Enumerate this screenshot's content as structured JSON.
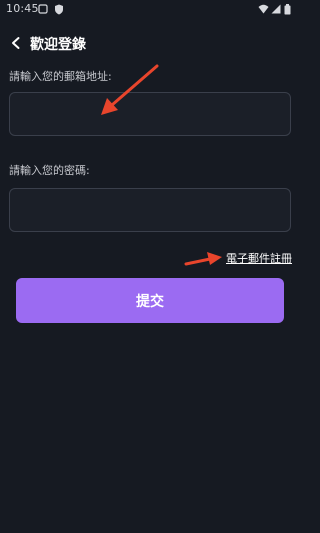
{
  "status_bar": {
    "time": "10:45",
    "icons": [
      "notification-icon",
      "shield-icon",
      "wifi-icon",
      "signal-icon",
      "battery-icon"
    ]
  },
  "header": {
    "back_icon": "chevron-left-icon",
    "title": "歡迎登錄"
  },
  "form": {
    "email_label": "請輸入您的郵箱地址:",
    "email_value": "",
    "password_label": "請輸入您的密碼:",
    "password_value": "",
    "register_link": "電子郵件註冊",
    "submit_label": "提交"
  },
  "colors": {
    "background": "#161a22",
    "input_background": "#1b1f28",
    "input_border": "#3a3f4b",
    "accent": "#9b6bf2",
    "annotation": "#e8452c"
  }
}
